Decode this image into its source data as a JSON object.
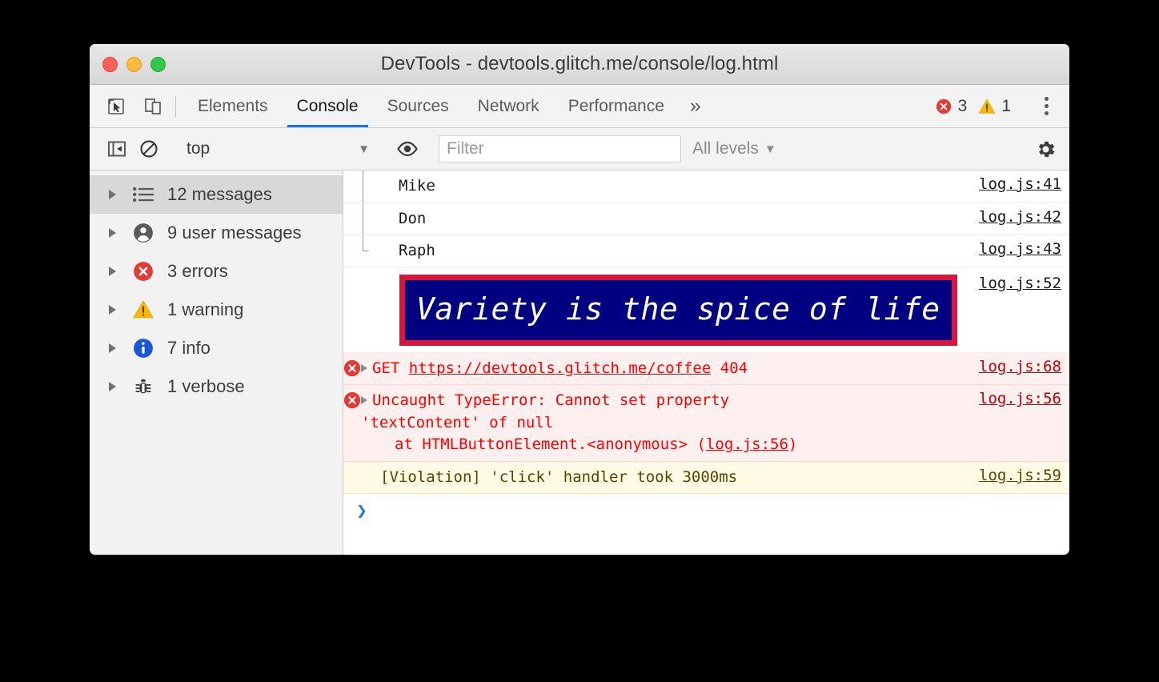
{
  "window": {
    "title": "DevTools - devtools.glitch.me/console/log.html",
    "traffic_lights": [
      "close-red",
      "minimize-yellow",
      "maximize-green"
    ]
  },
  "tabbar": {
    "icons": [
      {
        "name": "inspect-element-icon",
        "label": "Inspect element"
      },
      {
        "name": "device-toolbar-icon",
        "label": "Toggle device toolbar"
      }
    ],
    "tabs": [
      {
        "label": "Elements",
        "active": false
      },
      {
        "label": "Console",
        "active": true
      },
      {
        "label": "Sources",
        "active": false
      },
      {
        "label": "Network",
        "active": false
      },
      {
        "label": "Performance",
        "active": false
      }
    ],
    "more_label": "»",
    "error_count": "3",
    "warning_count": "1",
    "menu_label": "Customize and control DevTools"
  },
  "filterbar": {
    "sidebar_toggle_label": "Hide console sidebar",
    "clear_label": "Clear console",
    "context": "top",
    "context_caret": "▼",
    "live_expression_label": "Create live expression",
    "filter_placeholder": "Filter",
    "filter_value": "",
    "levels_label": "All levels",
    "levels_caret": "▼",
    "settings_label": "Console settings"
  },
  "sidebar": {
    "items": [
      {
        "label": "12 messages",
        "icon": "list-icon",
        "selected": true
      },
      {
        "label": "9 user messages",
        "icon": "user-icon",
        "selected": false
      },
      {
        "label": "3 errors",
        "icon": "error-icon",
        "selected": false
      },
      {
        "label": "1 warning",
        "icon": "warning-icon",
        "selected": false
      },
      {
        "label": "7 info",
        "icon": "info-icon",
        "selected": false
      },
      {
        "label": "1 verbose",
        "icon": "bug-icon",
        "selected": false
      }
    ]
  },
  "console": {
    "rows": [
      {
        "kind": "group",
        "text": "Mike",
        "source": "log.js:41"
      },
      {
        "kind": "group",
        "text": "Don",
        "source": "log.js:42"
      },
      {
        "kind": "group-last",
        "text": "Raph",
        "source": "log.js:43"
      },
      {
        "kind": "styled",
        "text": "Variety is the spice of life",
        "source": "log.js:52",
        "bg": "#000080",
        "border": "#dc143c",
        "color": "#ffffff"
      },
      {
        "kind": "error",
        "method": "GET",
        "url": "https://devtools.glitch.me/coffee",
        "status": "404",
        "source": "log.js:68"
      },
      {
        "kind": "error-stack",
        "line1": "Uncaught TypeError: Cannot set property",
        "line2": "'textContent' of null",
        "line3_prefix": "at HTMLButtonElement.<anonymous> (",
        "line3_link": "log.js:56",
        "line3_suffix": ")",
        "source": "log.js:56"
      },
      {
        "kind": "warning",
        "text": "[Violation] 'click' handler took 3000ms",
        "source": "log.js:59"
      }
    ],
    "prompt_chevron": "❯"
  },
  "colors": {
    "accent": "#1a73e8",
    "error": "#ff0000",
    "error_bg": "#fff0f0",
    "warning_bg": "#fffbe5",
    "warning_text": "#5c4400",
    "banner_bg": "#000080",
    "banner_border": "#dc143c"
  }
}
